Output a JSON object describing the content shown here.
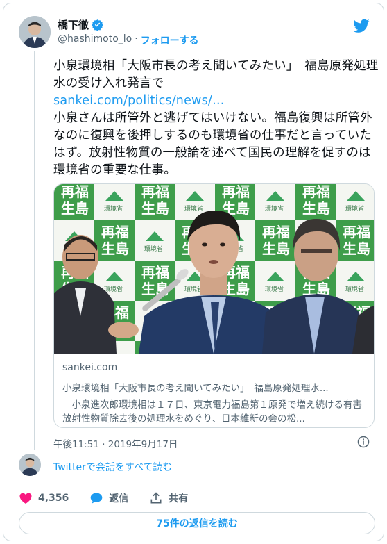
{
  "author": {
    "display_name": "橋下徹",
    "handle": "@hashimoto_lo",
    "separator": "·",
    "follow_label": "フォローする"
  },
  "tweet": {
    "line1": "小泉環境相「大阪市長の考え聞いてみたい」　福島原発処理水の受け入れ発言で",
    "link": "sankei.com/politics/news/…",
    "body": "小泉さんは所管外と逃げてはいけない。福島復興は所管外なのに復興を後押しするのも環境省の仕事だと言っていたはず。放射性物質の一般論を述べて国民の理解を促すのは環境省の重要な仕事。"
  },
  "link_card": {
    "domain": "sankei.com",
    "title": "小泉環境相「大阪市長の考え聞いてみたい」　福島原発処理水...",
    "description": "　小泉進次郎環境相は１７日、東京電力福島第１原発で増え続ける有害放射性物質除去後の処理水をめぐり、日本維新の会の松...",
    "backdrop_texts": [
      "再福",
      "生島",
      "環境省"
    ]
  },
  "timestamp": "午後11:51 · 2019年9月17日",
  "read_all": "Twitterで会話をすべて読む",
  "actions": {
    "like_count": "4,356",
    "reply_label": "返信",
    "share_label": "共有"
  },
  "replies_button": "75件の返信を読む",
  "colors": {
    "accent": "#1d9bf0",
    "like": "#f91880",
    "muted": "#536471",
    "border": "#cfd9de"
  }
}
